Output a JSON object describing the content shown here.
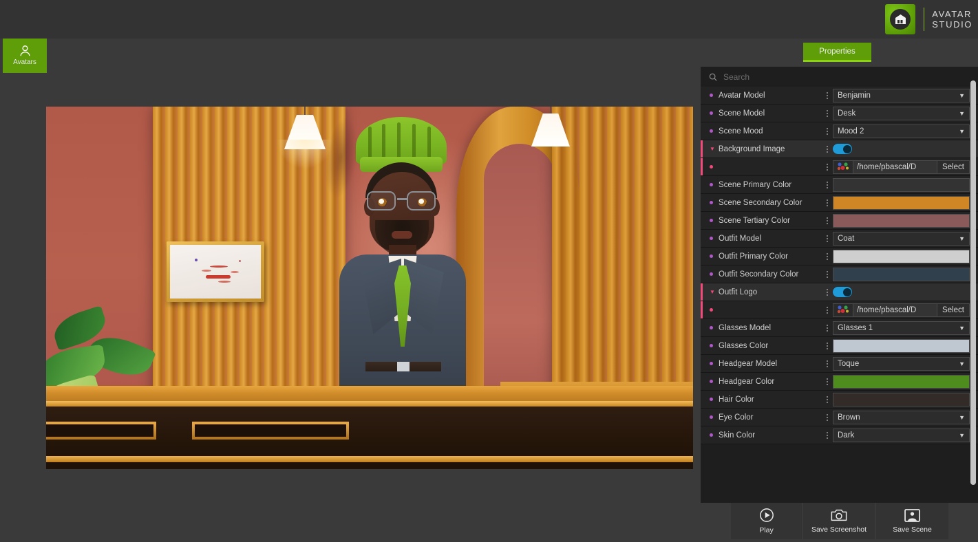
{
  "brand": {
    "line1": "AVATAR",
    "line2": "STUDIO",
    "logo_icon": "avatar-studio-logo-icon",
    "logo_color": "#62a408"
  },
  "left_tabs": [
    {
      "label": "Avatars",
      "icon": "person-icon",
      "active": true
    }
  ],
  "top_tabs": [
    {
      "label": "Properties",
      "active": true,
      "color": "#5f9e09"
    }
  ],
  "search": {
    "placeholder": "Search",
    "value": "",
    "icon": "search-icon"
  },
  "properties": [
    {
      "label": "Avatar Model",
      "type": "dropdown",
      "value": "Benjamin",
      "bullet": "purple"
    },
    {
      "label": "Scene Model",
      "type": "dropdown",
      "value": "Desk",
      "bullet": "purple"
    },
    {
      "label": "Scene Mood",
      "type": "dropdown",
      "value": "Mood 2",
      "bullet": "purple"
    },
    {
      "label": "Background Image",
      "type": "toggle",
      "value": "on",
      "bullet": "pink",
      "expanded": true,
      "highlight": true
    },
    {
      "label": "",
      "type": "file",
      "value": "/home/pbascal/D",
      "button": "Select",
      "bullet": "pink",
      "child": true,
      "thumb": "image-thumbnail-icon"
    },
    {
      "label": "Scene Primary Color",
      "type": "color",
      "value": "#333333",
      "bullet": "purple"
    },
    {
      "label": "Scene Secondary Color",
      "type": "color",
      "value": "#d08624",
      "bullet": "purple"
    },
    {
      "label": "Scene Tertiary Color",
      "type": "color",
      "value": "#8a5a5a",
      "bullet": "purple"
    },
    {
      "label": "Outfit Model",
      "type": "dropdown",
      "value": "Coat",
      "bullet": "purple"
    },
    {
      "label": "Outfit Primary Color",
      "type": "color",
      "value": "#cfcfcf",
      "bullet": "purple"
    },
    {
      "label": "Outfit Secondary Color",
      "type": "color",
      "value": "#30404c",
      "bullet": "purple"
    },
    {
      "label": "Outfit Logo",
      "type": "toggle",
      "value": "on",
      "bullet": "pink",
      "expanded": true,
      "highlight": true
    },
    {
      "label": "",
      "type": "file",
      "value": "/home/pbascal/D",
      "button": "Select",
      "bullet": "pink",
      "child": true,
      "thumb": "image-thumbnail-icon"
    },
    {
      "label": "Glasses Model",
      "type": "dropdown",
      "value": "Glasses 1",
      "bullet": "purple"
    },
    {
      "label": "Glasses Color",
      "type": "color",
      "value": "#bfc8d0",
      "bullet": "purple"
    },
    {
      "label": "Headgear Model",
      "type": "dropdown",
      "value": "Toque",
      "bullet": "purple"
    },
    {
      "label": "Headgear Color",
      "type": "color",
      "value": "#4f8c1e",
      "bullet": "purple"
    },
    {
      "label": "Hair Color",
      "type": "color",
      "value": "#332b28",
      "bullet": "purple"
    },
    {
      "label": "Eye Color",
      "type": "dropdown",
      "value": "Brown",
      "bullet": "purple"
    },
    {
      "label": "Skin Color",
      "type": "dropdown",
      "value": "Dark",
      "bullet": "purple"
    }
  ],
  "bottom_buttons": [
    {
      "label": "Play",
      "icon": "play-circle-icon"
    },
    {
      "label": "Save Screenshot",
      "icon": "camera-icon"
    },
    {
      "label": "Save Scene",
      "icon": "photo-portrait-icon"
    }
  ],
  "viewport": {
    "name": "3d-scene-viewport",
    "scene": "Desk",
    "avatar": "Benjamin",
    "headgear": "Toque",
    "outfit": "Coat"
  }
}
